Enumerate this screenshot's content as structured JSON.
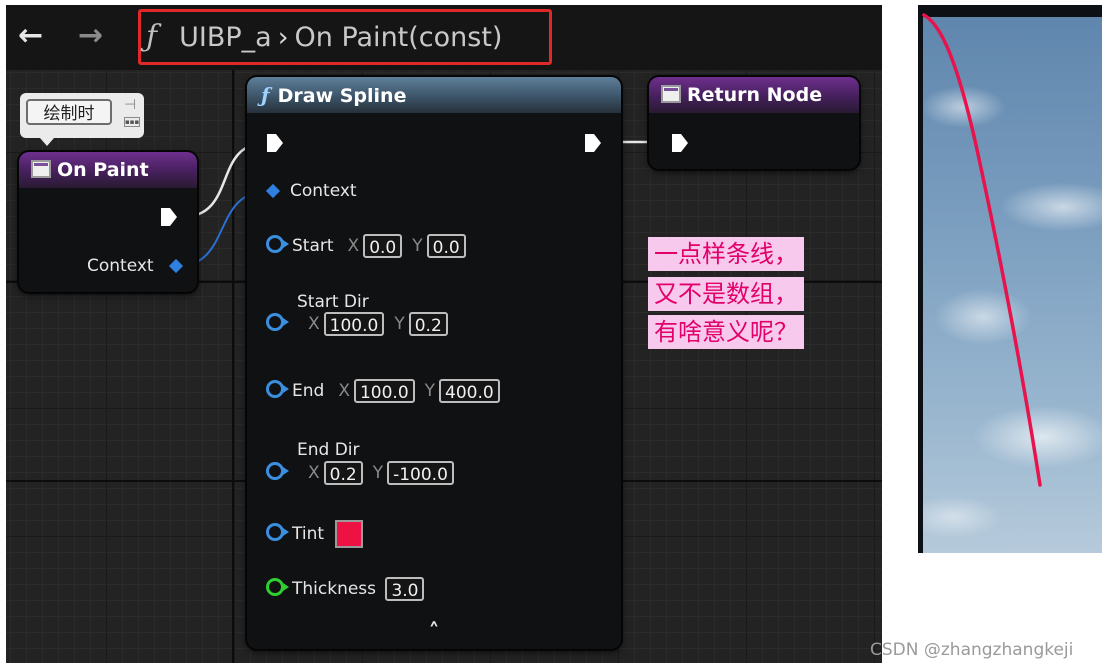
{
  "toolbar": {
    "back_arrow": "←",
    "forward_arrow": "→",
    "breadcrumb": {
      "function_glyph": "ƒ",
      "graph": "UIBP_a",
      "separator": "›",
      "function": "On Paint(const)"
    }
  },
  "comment": {
    "label": "绘制时",
    "pin_glyph": "⊣"
  },
  "on_paint_node": {
    "title": "On Paint",
    "context_label": "Context"
  },
  "draw_spline_node": {
    "title": "Draw Spline",
    "function_glyph": "ƒ",
    "pins": {
      "context": "Context",
      "start": {
        "label": "Start",
        "x_axis": "X",
        "x": "0.0",
        "y_axis": "Y",
        "y": "0.0"
      },
      "start_dir": {
        "label": "Start Dir",
        "x_axis": "X",
        "x": "100.0",
        "y_axis": "Y",
        "y": "0.2"
      },
      "end": {
        "label": "End",
        "x_axis": "X",
        "x": "100.0",
        "y_axis": "Y",
        "y": "400.0"
      },
      "end_dir": {
        "label": "End Dir",
        "x_axis": "X",
        "x": "0.2",
        "y_axis": "Y",
        "y": "-100.0"
      },
      "tint": {
        "label": "Tint",
        "color": "#ee1144"
      },
      "thickness": {
        "label": "Thickness",
        "value": "3.0"
      }
    },
    "collapse_glyph": "˄"
  },
  "return_node": {
    "title": "Return Node"
  },
  "annotation": {
    "lines": [
      "一点样条线，",
      "又不是数组，",
      "有啥意义呢？"
    ],
    "text_color": "#e2006a",
    "background": "#f7c9ec"
  },
  "preview": {
    "curve_color": "#e8134d"
  },
  "watermark": "CSDN @zhangzhangkeji",
  "colors": {
    "pin_object": "#2f7fe0",
    "pin_vector": "#3b8fe0",
    "pin_float": "#2fcf2f",
    "event_header": "#6e2f8e",
    "function_header": "#5f7f9a",
    "highlight_box": "#e02828"
  }
}
